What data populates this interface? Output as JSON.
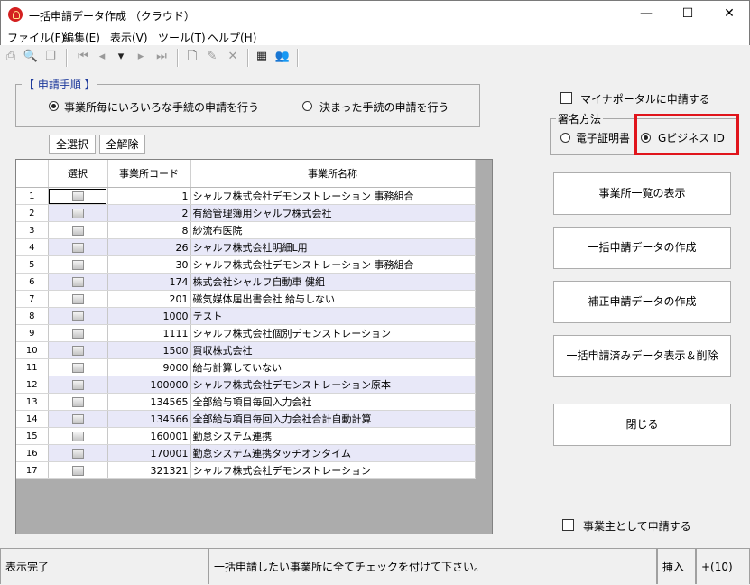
{
  "window": {
    "title": "一括申請データ作成 （クラウド）",
    "minimize": "—",
    "maximize": "☐",
    "close": "✕"
  },
  "menu": [
    "ファイル(F)",
    "編集(E)",
    "表示(V)",
    "ツール(T)",
    "ヘルプ(H)"
  ],
  "toolbar": {
    "icons": [
      "print-icon",
      "print-preview-icon",
      "page-setup-icon",
      "first-record-icon",
      "prev-record-icon",
      "dropdown-icon",
      "next-record-icon",
      "last-record-icon",
      "new-icon",
      "edit-icon",
      "delete-icon",
      "calculator-icon",
      "users-icon"
    ]
  },
  "procedure": {
    "legend": "【 申請手順 】",
    "option1": "事業所毎にいろいろな手続の申請を行う",
    "option2": "決まった手続の申請を行う",
    "selected": "option1"
  },
  "buttons": {
    "select_all": "全選択",
    "deselect_all": "全解除"
  },
  "table": {
    "headers": [
      "選択",
      "事業所コード",
      "事業所名称"
    ],
    "rows": [
      {
        "no": "1",
        "code": "1",
        "name": "シャルフ株式会社デモンストレーション 事務組合"
      },
      {
        "no": "2",
        "code": "2",
        "name": "有給管理簿用シャルフ株式会社"
      },
      {
        "no": "3",
        "code": "8",
        "name": "紗流布医院"
      },
      {
        "no": "4",
        "code": "26",
        "name": "シャルフ株式会社明細L用"
      },
      {
        "no": "5",
        "code": "30",
        "name": "シャルフ株式会社デモンストレーション 事務組合"
      },
      {
        "no": "6",
        "code": "174",
        "name": "株式会社シャルフ自動車 健組"
      },
      {
        "no": "7",
        "code": "201",
        "name": "磁気媒体届出書会社 給与しない"
      },
      {
        "no": "8",
        "code": "1000",
        "name": "テスト"
      },
      {
        "no": "9",
        "code": "1111",
        "name": "シャルフ株式会社個別デモンストレーション"
      },
      {
        "no": "10",
        "code": "1500",
        "name": "買収株式会社"
      },
      {
        "no": "11",
        "code": "9000",
        "name": "給与計算していない"
      },
      {
        "no": "12",
        "code": "100000",
        "name": "シャルフ株式会社デモンストレーション原本"
      },
      {
        "no": "13",
        "code": "134565",
        "name": "全部給与項目毎回入力会社"
      },
      {
        "no": "14",
        "code": "134566",
        "name": "全部給与項目毎回入力会社合計自動計算"
      },
      {
        "no": "15",
        "code": "160001",
        "name": "勤怠システム連携"
      },
      {
        "no": "16",
        "code": "170001",
        "name": "勤怠システム連携タッチオンタイム"
      },
      {
        "no": "17",
        "code": "321321",
        "name": "シャルフ株式会社デモンストレーション"
      }
    ]
  },
  "right": {
    "mynaportal_label": "マイナポータルに申請する",
    "signature_legend": "署名方法",
    "sig_option1": "電子証明書",
    "sig_option2": "Gビジネス ID",
    "sig_selected": "option2",
    "highlight_color": "#e0141b",
    "btn_list": "事業所一覧の表示",
    "btn_create": "一括申請データの作成",
    "btn_correct": "補正申請データの作成",
    "btn_view_delete": "一括申請済みデータ表示＆削除",
    "btn_close": "閉じる",
    "employer_label": "事業主として申請する"
  },
  "status": {
    "left": "表示完了",
    "message": "一括申請したい事業所に全てチェックを付けて下さい。",
    "insert": "挿入",
    "count": "+(10)"
  }
}
